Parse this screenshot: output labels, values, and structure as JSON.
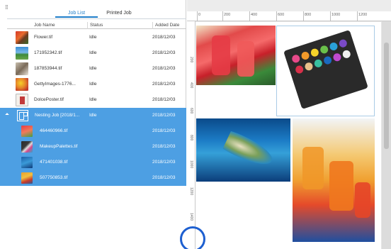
{
  "tabs": [
    {
      "label": "Job List",
      "active": true
    },
    {
      "label": "Printed Job",
      "active": false
    }
  ],
  "columns": {
    "name": "Job Name",
    "status": "Status",
    "date": "Added Date"
  },
  "rows": [
    {
      "name": "Flower.tif",
      "status": "Idle",
      "date": "2018/12/03",
      "thumb": "flower-thumbnail"
    },
    {
      "name": "171952342.tif",
      "status": "Idle",
      "date": "2018/12/03",
      "thumb": "landscape-thumbnail"
    },
    {
      "name": "187853944.tif",
      "status": "Idle",
      "date": "2018/12/03",
      "thumb": "interior-thumbnail"
    },
    {
      "name": "GettyImages-1776...",
      "status": "Idle",
      "date": "2018/12/03",
      "thumb": "sunflower-thumbnail"
    },
    {
      "name": "DolcePoster.tif",
      "status": "Idle",
      "date": "2018/12/03",
      "thumb": "poster-thumbnail"
    },
    {
      "name": "Nesting Job [2018/1...",
      "status": "Idle",
      "date": "2018/12/03",
      "thumb": "nesting-job-icon"
    },
    {
      "name": "464460966.tif",
      "status": "",
      "date": "2018/12/03",
      "thumb": "strawberry-drink-thumbnail"
    },
    {
      "name": "MakeupPalettes.tif",
      "status": "",
      "date": "2018/12/03",
      "thumb": "makeup-palette-thumbnail"
    },
    {
      "name": "471401038.tif",
      "status": "",
      "date": "2018/12/03",
      "thumb": "island-thumbnail"
    },
    {
      "name": "507750853.tif",
      "status": "",
      "date": "2018/12/03",
      "thumb": "juice-thumbnail"
    }
  ],
  "ruler": {
    "top_ticks": [
      "0",
      "200",
      "400",
      "600",
      "800",
      "1000",
      "1200"
    ],
    "left_ticks": [
      "200",
      "400",
      "600",
      "800",
      "1000",
      "1200",
      "1400"
    ]
  },
  "colors": {
    "selection": "#4d9fe3",
    "active_tab": "#1f7ec9",
    "highlight_circle": "#1d5fd0"
  }
}
